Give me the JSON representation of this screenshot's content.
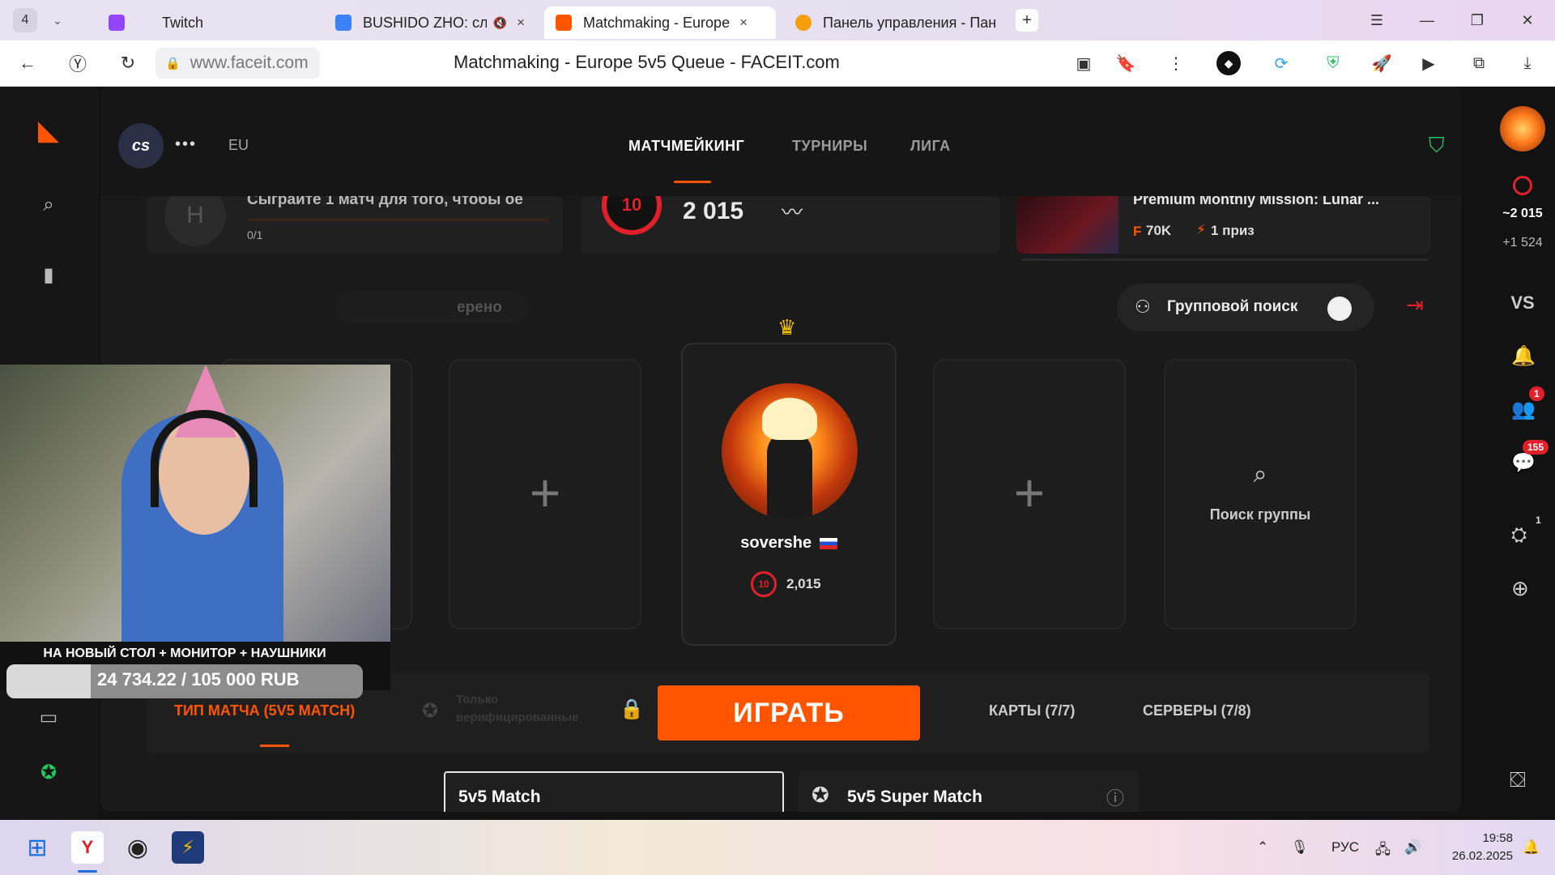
{
  "browser": {
    "tab_counter": "4",
    "tabs": [
      {
        "label": "Twitch",
        "color": "#9146ff"
      },
      {
        "label": "BUSHIDO ZHO: слуш",
        "color": "#3b82f6"
      },
      {
        "label": "Matchmaking - Europe",
        "color": "#ff5500"
      },
      {
        "label": "Панель управления - Пан",
        "color": "#f59e0b"
      }
    ],
    "url": "www.faceit.com",
    "page_title": "Matchmaking - Europe 5v5 Queue - FACEIT.com"
  },
  "faceit": {
    "accent": "#ff5500",
    "game_logo": "cs",
    "region": "EU",
    "nav": {
      "matchmaking": "МАТЧМЕЙКИНГ",
      "tournaments": "ТУРНИРЫ",
      "league": "ЛИГА"
    },
    "mission": {
      "text": "Сыграйте 1 матч для того, чтобы ое",
      "progress_text": "0/1",
      "progress": 0
    },
    "elo_card": {
      "level": "10",
      "elo": "2 015"
    },
    "promo": {
      "title": "Premium Monthly Mission: Lunar ...",
      "points": "70K",
      "prize": "1 приз"
    },
    "verified_text": "ерено",
    "group_search": {
      "label": "Групповой поиск",
      "enabled": false
    },
    "party": {
      "name": "sovershe",
      "level": "10",
      "elo": "2,015"
    },
    "find_group": "Поиск группы",
    "bottom": {
      "match_type": "ТИП МАТЧА (5V5 MATCH)",
      "verified_only": "Только верифицированные",
      "play": "ИГРАТЬ",
      "maps": "КАРТЫ (7/7)",
      "servers": "СЕРВЕРЫ (7/8)"
    },
    "modes": {
      "regular": "5v5 Match",
      "super": "5v5 Super Match"
    },
    "right_rail": {
      "elo": "~2 015",
      "elo_delta": "+1 524",
      "vs": "VS",
      "friends_badge": "1",
      "chat_badge": "155",
      "party_badge": "1"
    }
  },
  "stream_overlay": {
    "goal_label": "НА НОВЫЙ СТОЛ + МОНИТОР + НАУШНИКИ",
    "goal_amount": "24 734.22 / 105 000 RUB",
    "goal_progress": 0.236
  },
  "taskbar": {
    "lang": "РУС",
    "time": "19:58",
    "date": "26.02.2025"
  }
}
